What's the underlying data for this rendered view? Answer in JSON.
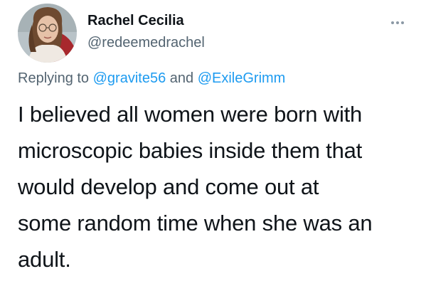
{
  "tweet": {
    "author": {
      "display_name": "Rachel Cecilia",
      "handle": "@redeemedrachel",
      "avatar_icon": "profile-photo"
    },
    "more_icon": "ellipsis-icon",
    "reply": {
      "prefix": "Replying to",
      "mention_1": "@gravite56",
      "joiner": "and",
      "mention_2": "@ExileGrimm"
    },
    "text_lines": [
      "I believed all women were born with",
      "microscopic babies inside them that",
      "would develop and come out at",
      "some random time when she was an",
      "adult."
    ],
    "colors": {
      "text": "#0f1419",
      "secondary": "#536471",
      "link": "#1d9bf0"
    }
  }
}
